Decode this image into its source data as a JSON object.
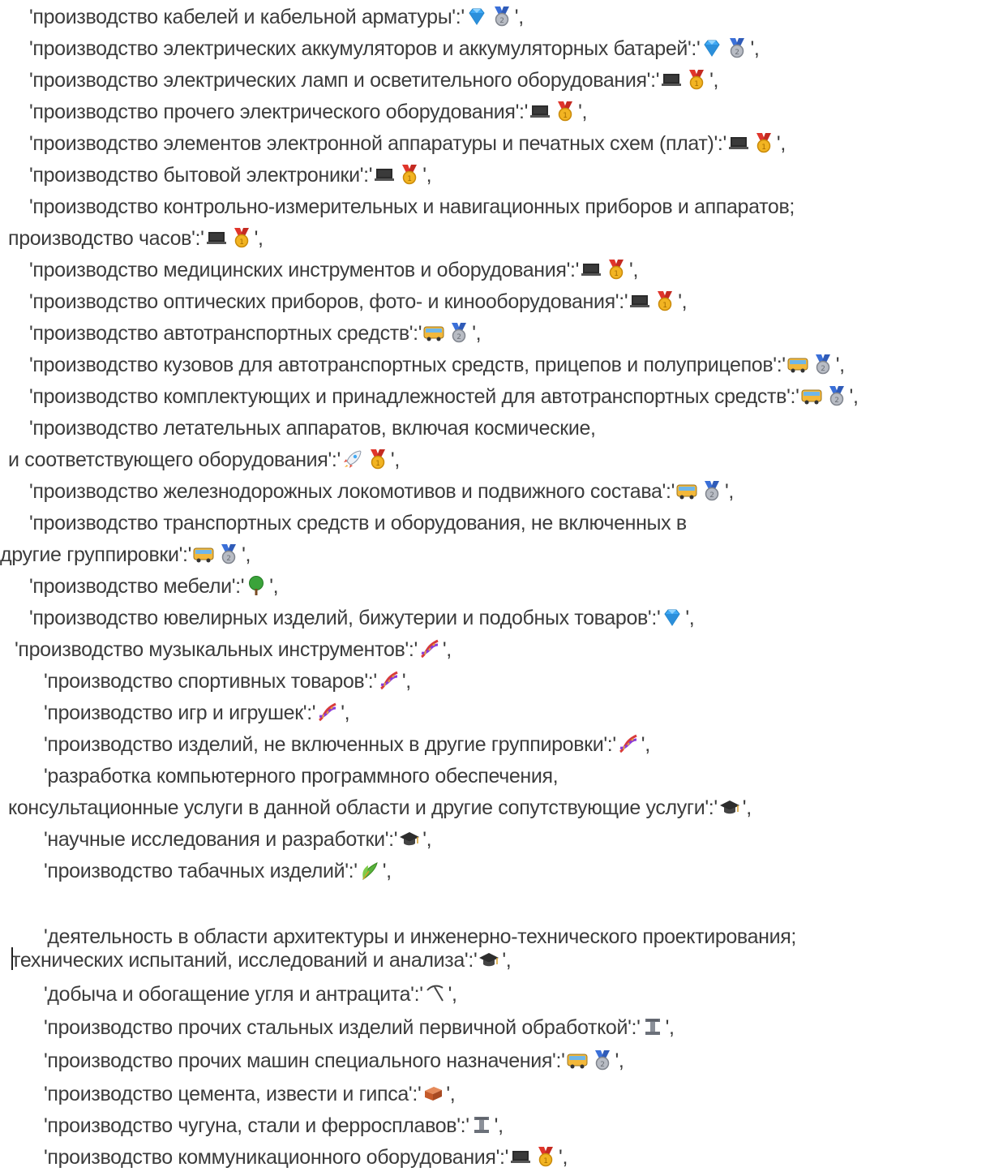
{
  "icon_legend": {
    "gem-icon": "💎",
    "silver-medal-icon": "🥈",
    "gold-medal-icon": "🥇",
    "laptop-icon": "💻",
    "bus-icon": "🚌",
    "rocket-icon": "🚀",
    "tree-icon": "🌳",
    "dna-icon": "🧬",
    "graduation-cap-icon": "🎓",
    "plant-icon": "🌿",
    "pick-icon": "⛏",
    "steel-beam-icon": "🏗",
    "brick-icon": "🧱"
  },
  "lines": [
    {
      "text": "'производство кабелей и кабельной арматуры':'",
      "icons": [
        "gem-icon",
        "silver-medal-icon"
      ],
      "suffix": "',"
    },
    {
      "text": "'производство электрических аккумуляторов и аккумуляторных батарей':'",
      "icons": [
        "gem-icon",
        "silver-medal-icon"
      ],
      "suffix": "',"
    },
    {
      "text": "'производство электрических ламп и осветительного оборудования':'",
      "icons": [
        "laptop-icon",
        "gold-medal-icon"
      ],
      "suffix": "',"
    },
    {
      "text": "'производство прочего электрического оборудования':'",
      "icons": [
        "laptop-icon",
        "gold-medal-icon"
      ],
      "suffix": "',"
    },
    {
      "text": "'производство элементов электронной аппаратуры и печатных схем (плат)':'",
      "icons": [
        "laptop-icon",
        "gold-medal-icon"
      ],
      "suffix": "',"
    },
    {
      "text": "'производство бытовой электроники':'",
      "icons": [
        "laptop-icon",
        "gold-medal-icon"
      ],
      "suffix": "',"
    },
    {
      "text": "'производство контрольно-измерительных и навигационных приборов и аппаратов;",
      "icons": [],
      "suffix": ""
    },
    {
      "text": "производство часов':'",
      "icons": [
        "laptop-icon",
        "gold-medal-icon"
      ],
      "suffix": "',"
    },
    {
      "text": "'производство медицинских инструментов и оборудования':'",
      "icons": [
        "laptop-icon",
        "gold-medal-icon"
      ],
      "suffix": "',"
    },
    {
      "text": "'производство оптических приборов, фото- и кинооборудования':'",
      "icons": [
        "laptop-icon",
        "gold-medal-icon"
      ],
      "suffix": "',"
    },
    {
      "text": "'производство автотранспортных средств':'",
      "icons": [
        "bus-icon",
        "silver-medal-icon"
      ],
      "suffix": "',"
    },
    {
      "text": "'производство кузовов для автотранспортных средств, прицепов и полуприцепов':'",
      "icons": [
        "bus-icon",
        "silver-medal-icon"
      ],
      "suffix": "',"
    },
    {
      "text": "'производство комплектующих и принадлежностей для автотранспортных средств':'",
      "icons": [
        "bus-icon",
        "silver-medal-icon"
      ],
      "suffix": "',"
    },
    {
      "text": "'производство летательных аппаратов, включая космические,",
      "icons": [],
      "suffix": ""
    },
    {
      "text": "и соответствующего оборудования':'",
      "icons": [
        "rocket-icon",
        "gold-medal-icon"
      ],
      "suffix": "',"
    },
    {
      "text": "'производство железнодорожных локомотивов и подвижного состава':'",
      "icons": [
        "bus-icon",
        "silver-medal-icon"
      ],
      "suffix": "',"
    },
    {
      "text": "'производство транспортных средств и оборудования, не включенных в",
      "icons": [],
      "suffix": ""
    },
    {
      "text": "другие группировки':'",
      "icons": [
        "bus-icon",
        "silver-medal-icon"
      ],
      "suffix": "',"
    },
    {
      "text": "'производство мебели':'",
      "icons": [
        "tree-icon"
      ],
      "suffix": "',"
    },
    {
      "text": "'производство ювелирных изделий, бижутерии и подобных товаров':'",
      "icons": [
        "gem-icon"
      ],
      "suffix": "',"
    },
    {
      "text": "'производство музыкальных инструментов':'",
      "icons": [
        "dna-icon"
      ],
      "suffix": "',"
    },
    {
      "text": "'производство спортивных товаров':'",
      "icons": [
        "dna-icon"
      ],
      "suffix": "',"
    },
    {
      "text": "'производство игр и игрушек':'",
      "icons": [
        "dna-icon"
      ],
      "suffix": "',"
    },
    {
      "text": "'производство изделий, не включенных в другие группировки':'",
      "icons": [
        "dna-icon"
      ],
      "suffix": "',"
    },
    {
      "text": "'разработка компьютерного программного обеспечения,",
      "icons": [],
      "suffix": ""
    },
    {
      "text": "консультационные услуги в данной области и другие сопутствующие услуги':'",
      "icons": [
        "graduation-cap-icon"
      ],
      "suffix": "',"
    },
    {
      "text": "'научные исследования и разработки':'",
      "icons": [
        "graduation-cap-icon"
      ],
      "suffix": "',"
    },
    {
      "text": "'производство табачных изделий':'",
      "icons": [
        "plant-icon"
      ],
      "suffix": "',"
    },
    {
      "text": "'деятельность в области архитектуры и инженерно-технического проектирования;",
      "icons": [],
      "suffix": ""
    },
    {
      "text": "технических испытаний, исследований и анализа':'",
      "icons": [
        "graduation-cap-icon"
      ],
      "suffix": "',"
    },
    {
      "text": "'добыча и обогащение угля и антрацита':'",
      "icons": [
        "pick-icon"
      ],
      "suffix": "',"
    },
    {
      "text": "'производство прочих стальных изделий первичной обработкой':'",
      "icons": [
        "steel-beam-icon"
      ],
      "suffix": "',"
    },
    {
      "text": "'производство прочих машин специального назначения':'",
      "icons": [
        "bus-icon",
        "silver-medal-icon"
      ],
      "suffix": "',"
    },
    {
      "text": "'производство цемента, извести и гипса':'",
      "icons": [
        "brick-icon"
      ],
      "suffix": "',"
    },
    {
      "text": "'производство чугуна, стали и ферросплавов':'",
      "icons": [
        "steel-beam-icon"
      ],
      "suffix": "',"
    },
    {
      "text": "'производство коммуникационного оборудования':'",
      "icons": [
        "laptop-icon",
        "gold-medal-icon"
      ],
      "suffix": "',"
    }
  ]
}
